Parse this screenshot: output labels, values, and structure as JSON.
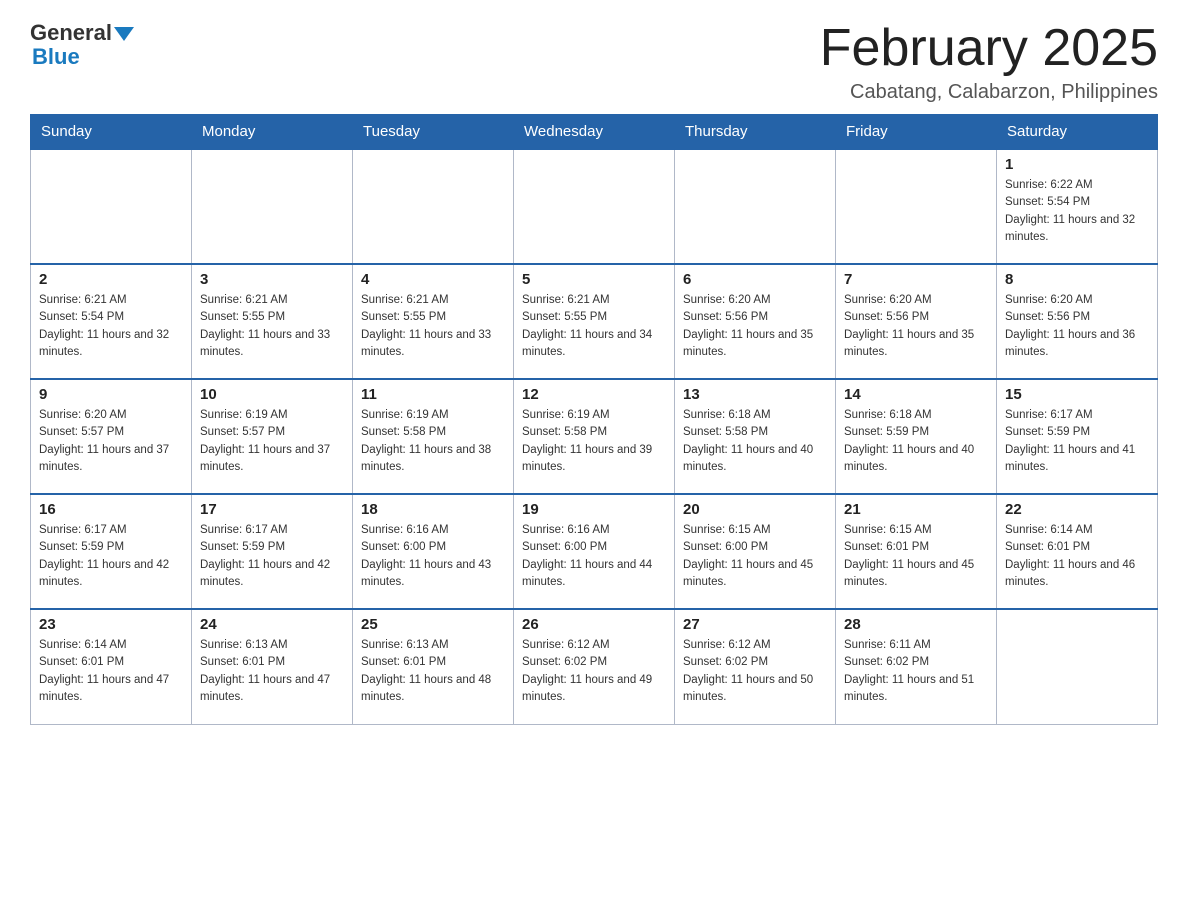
{
  "header": {
    "logo": {
      "text_general": "General",
      "text_blue": "Blue"
    },
    "title": "February 2025",
    "subtitle": "Cabatang, Calabarzon, Philippines"
  },
  "calendar": {
    "days_of_week": [
      "Sunday",
      "Monday",
      "Tuesday",
      "Wednesday",
      "Thursday",
      "Friday",
      "Saturday"
    ],
    "weeks": [
      [
        {
          "day": "",
          "sunrise": "",
          "sunset": "",
          "daylight": ""
        },
        {
          "day": "",
          "sunrise": "",
          "sunset": "",
          "daylight": ""
        },
        {
          "day": "",
          "sunrise": "",
          "sunset": "",
          "daylight": ""
        },
        {
          "day": "",
          "sunrise": "",
          "sunset": "",
          "daylight": ""
        },
        {
          "day": "",
          "sunrise": "",
          "sunset": "",
          "daylight": ""
        },
        {
          "day": "",
          "sunrise": "",
          "sunset": "",
          "daylight": ""
        },
        {
          "day": "1",
          "sunrise": "Sunrise: 6:22 AM",
          "sunset": "Sunset: 5:54 PM",
          "daylight": "Daylight: 11 hours and 32 minutes."
        }
      ],
      [
        {
          "day": "2",
          "sunrise": "Sunrise: 6:21 AM",
          "sunset": "Sunset: 5:54 PM",
          "daylight": "Daylight: 11 hours and 32 minutes."
        },
        {
          "day": "3",
          "sunrise": "Sunrise: 6:21 AM",
          "sunset": "Sunset: 5:55 PM",
          "daylight": "Daylight: 11 hours and 33 minutes."
        },
        {
          "day": "4",
          "sunrise": "Sunrise: 6:21 AM",
          "sunset": "Sunset: 5:55 PM",
          "daylight": "Daylight: 11 hours and 33 minutes."
        },
        {
          "day": "5",
          "sunrise": "Sunrise: 6:21 AM",
          "sunset": "Sunset: 5:55 PM",
          "daylight": "Daylight: 11 hours and 34 minutes."
        },
        {
          "day": "6",
          "sunrise": "Sunrise: 6:20 AM",
          "sunset": "Sunset: 5:56 PM",
          "daylight": "Daylight: 11 hours and 35 minutes."
        },
        {
          "day": "7",
          "sunrise": "Sunrise: 6:20 AM",
          "sunset": "Sunset: 5:56 PM",
          "daylight": "Daylight: 11 hours and 35 minutes."
        },
        {
          "day": "8",
          "sunrise": "Sunrise: 6:20 AM",
          "sunset": "Sunset: 5:56 PM",
          "daylight": "Daylight: 11 hours and 36 minutes."
        }
      ],
      [
        {
          "day": "9",
          "sunrise": "Sunrise: 6:20 AM",
          "sunset": "Sunset: 5:57 PM",
          "daylight": "Daylight: 11 hours and 37 minutes."
        },
        {
          "day": "10",
          "sunrise": "Sunrise: 6:19 AM",
          "sunset": "Sunset: 5:57 PM",
          "daylight": "Daylight: 11 hours and 37 minutes."
        },
        {
          "day": "11",
          "sunrise": "Sunrise: 6:19 AM",
          "sunset": "Sunset: 5:58 PM",
          "daylight": "Daylight: 11 hours and 38 minutes."
        },
        {
          "day": "12",
          "sunrise": "Sunrise: 6:19 AM",
          "sunset": "Sunset: 5:58 PM",
          "daylight": "Daylight: 11 hours and 39 minutes."
        },
        {
          "day": "13",
          "sunrise": "Sunrise: 6:18 AM",
          "sunset": "Sunset: 5:58 PM",
          "daylight": "Daylight: 11 hours and 40 minutes."
        },
        {
          "day": "14",
          "sunrise": "Sunrise: 6:18 AM",
          "sunset": "Sunset: 5:59 PM",
          "daylight": "Daylight: 11 hours and 40 minutes."
        },
        {
          "day": "15",
          "sunrise": "Sunrise: 6:17 AM",
          "sunset": "Sunset: 5:59 PM",
          "daylight": "Daylight: 11 hours and 41 minutes."
        }
      ],
      [
        {
          "day": "16",
          "sunrise": "Sunrise: 6:17 AM",
          "sunset": "Sunset: 5:59 PM",
          "daylight": "Daylight: 11 hours and 42 minutes."
        },
        {
          "day": "17",
          "sunrise": "Sunrise: 6:17 AM",
          "sunset": "Sunset: 5:59 PM",
          "daylight": "Daylight: 11 hours and 42 minutes."
        },
        {
          "day": "18",
          "sunrise": "Sunrise: 6:16 AM",
          "sunset": "Sunset: 6:00 PM",
          "daylight": "Daylight: 11 hours and 43 minutes."
        },
        {
          "day": "19",
          "sunrise": "Sunrise: 6:16 AM",
          "sunset": "Sunset: 6:00 PM",
          "daylight": "Daylight: 11 hours and 44 minutes."
        },
        {
          "day": "20",
          "sunrise": "Sunrise: 6:15 AM",
          "sunset": "Sunset: 6:00 PM",
          "daylight": "Daylight: 11 hours and 45 minutes."
        },
        {
          "day": "21",
          "sunrise": "Sunrise: 6:15 AM",
          "sunset": "Sunset: 6:01 PM",
          "daylight": "Daylight: 11 hours and 45 minutes."
        },
        {
          "day": "22",
          "sunrise": "Sunrise: 6:14 AM",
          "sunset": "Sunset: 6:01 PM",
          "daylight": "Daylight: 11 hours and 46 minutes."
        }
      ],
      [
        {
          "day": "23",
          "sunrise": "Sunrise: 6:14 AM",
          "sunset": "Sunset: 6:01 PM",
          "daylight": "Daylight: 11 hours and 47 minutes."
        },
        {
          "day": "24",
          "sunrise": "Sunrise: 6:13 AM",
          "sunset": "Sunset: 6:01 PM",
          "daylight": "Daylight: 11 hours and 47 minutes."
        },
        {
          "day": "25",
          "sunrise": "Sunrise: 6:13 AM",
          "sunset": "Sunset: 6:01 PM",
          "daylight": "Daylight: 11 hours and 48 minutes."
        },
        {
          "day": "26",
          "sunrise": "Sunrise: 6:12 AM",
          "sunset": "Sunset: 6:02 PM",
          "daylight": "Daylight: 11 hours and 49 minutes."
        },
        {
          "day": "27",
          "sunrise": "Sunrise: 6:12 AM",
          "sunset": "Sunset: 6:02 PM",
          "daylight": "Daylight: 11 hours and 50 minutes."
        },
        {
          "day": "28",
          "sunrise": "Sunrise: 6:11 AM",
          "sunset": "Sunset: 6:02 PM",
          "daylight": "Daylight: 11 hours and 51 minutes."
        },
        {
          "day": "",
          "sunrise": "",
          "sunset": "",
          "daylight": ""
        }
      ]
    ]
  }
}
